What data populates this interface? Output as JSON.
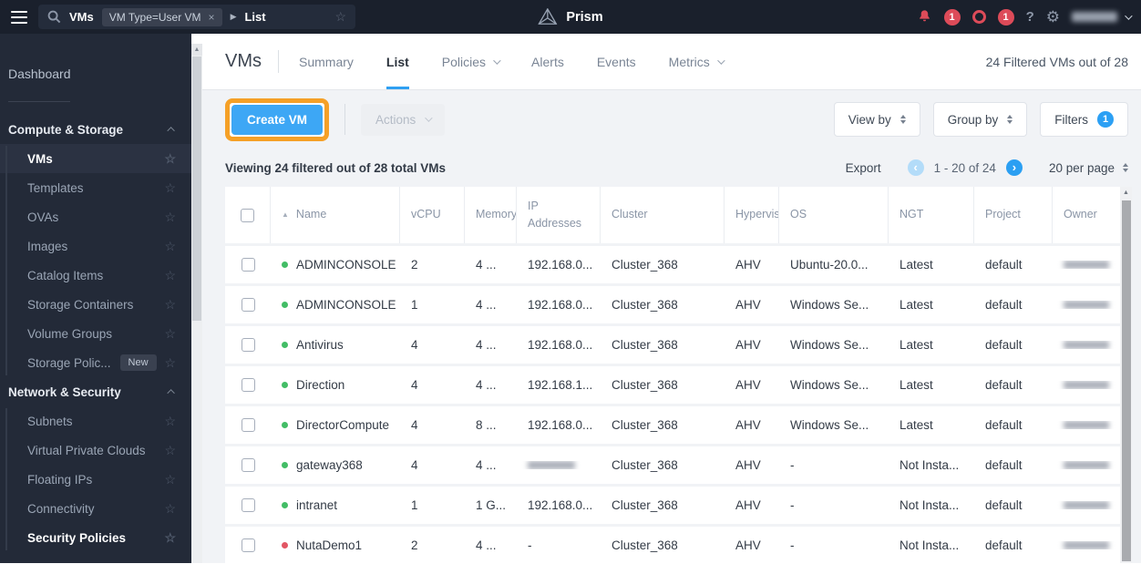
{
  "topbar": {
    "entity": "VMs",
    "filter_chip": "VM Type=User VM",
    "chip_close": "×",
    "crumb": "List",
    "brand": "Prism",
    "alert_badge": "1",
    "anomaly_badge": "1",
    "help_label": "?"
  },
  "sidebar": {
    "dashboard": "Dashboard",
    "sections": [
      {
        "label": "Compute & Storage",
        "items": [
          {
            "label": "VMs",
            "active": true
          },
          {
            "label": "Templates"
          },
          {
            "label": "OVAs"
          },
          {
            "label": "Images"
          },
          {
            "label": "Catalog Items"
          },
          {
            "label": "Storage Containers"
          },
          {
            "label": "Volume Groups"
          },
          {
            "label": "Storage Polic...",
            "badge": "New"
          }
        ]
      },
      {
        "label": "Network & Security",
        "items": [
          {
            "label": "Subnets"
          },
          {
            "label": "Virtual Private Clouds"
          },
          {
            "label": "Floating IPs"
          },
          {
            "label": "Connectivity"
          },
          {
            "label": "Security Policies",
            "emphasis": true
          }
        ]
      }
    ]
  },
  "header": {
    "title": "VMs",
    "tabs": [
      {
        "label": "Summary"
      },
      {
        "label": "List",
        "active": true
      },
      {
        "label": "Policies",
        "dropdown": true
      },
      {
        "label": "Alerts"
      },
      {
        "label": "Events"
      },
      {
        "label": "Metrics",
        "dropdown": true
      }
    ],
    "filtered_summary": "24 Filtered VMs out of 28"
  },
  "toolbar": {
    "create_vm": "Create VM",
    "actions": "Actions",
    "view_by": "View by",
    "group_by": "Group by",
    "filters": "Filters",
    "filters_count": "1"
  },
  "infobar": {
    "viewing": "Viewing 24 filtered out of 28 total VMs",
    "export": "Export",
    "page_range": "1 - 20 of 24",
    "per_page": "20 per page"
  },
  "table": {
    "columns": [
      "Name",
      "vCPU",
      "Memory",
      "IP Addresses",
      "Cluster",
      "Hypervis",
      "OS",
      "NGT",
      "Project",
      "Owner"
    ],
    "sort_column": "Name",
    "rows": [
      {
        "status": "green",
        "name": "ADMINCONSOLE",
        "vcpu": "2",
        "memory": "4 ...",
        "ip": "192.168.0...",
        "cluster": "Cluster_368",
        "hypervisor": "AHV",
        "os": "Ubuntu-20.0...",
        "ngt": "Latest",
        "project": "default",
        "owner": null
      },
      {
        "status": "green",
        "name": "ADMINCONSOLE",
        "vcpu": "1",
        "memory": "4 ...",
        "ip": "192.168.0...",
        "cluster": "Cluster_368",
        "hypervisor": "AHV",
        "os": "Windows Se...",
        "ngt": "Latest",
        "project": "default",
        "owner": null
      },
      {
        "status": "green",
        "name": "Antivirus",
        "vcpu": "4",
        "memory": "4 ...",
        "ip": "192.168.0...",
        "cluster": "Cluster_368",
        "hypervisor": "AHV",
        "os": "Windows Se...",
        "ngt": "Latest",
        "project": "default",
        "owner": null
      },
      {
        "status": "green",
        "name": "Direction",
        "vcpu": "4",
        "memory": "4 ...",
        "ip": "192.168.1...",
        "cluster": "Cluster_368",
        "hypervisor": "AHV",
        "os": "Windows Se...",
        "ngt": "Latest",
        "project": "default",
        "owner": null
      },
      {
        "status": "green",
        "name": "DirectorCompute",
        "vcpu": "4",
        "memory": "8 ...",
        "ip": "192.168.0...",
        "cluster": "Cluster_368",
        "hypervisor": "AHV",
        "os": "Windows Se...",
        "ngt": "Latest",
        "project": "default",
        "owner": null
      },
      {
        "status": "green",
        "name": "gateway368",
        "vcpu": "4",
        "memory": "4 ...",
        "ip": null,
        "cluster": "Cluster_368",
        "hypervisor": "AHV",
        "os": "-",
        "ngt": "Not Insta...",
        "project": "default",
        "owner": null
      },
      {
        "status": "green",
        "name": "intranet",
        "vcpu": "1",
        "memory": "1 G...",
        "ip": "192.168.0...",
        "cluster": "Cluster_368",
        "hypervisor": "AHV",
        "os": "-",
        "ngt": "Not Insta...",
        "project": "default",
        "owner": null
      },
      {
        "status": "red",
        "name": "NutaDemo1",
        "vcpu": "2",
        "memory": "4 ...",
        "ip": "-",
        "cluster": "Cluster_368",
        "hypervisor": "AHV",
        "os": "-",
        "ngt": "Not Insta...",
        "project": "default",
        "owner": null
      }
    ]
  },
  "colors": {
    "accent_blue": "#3DA7F5",
    "highlight_orange": "#F5A027",
    "status_green": "#43BD66",
    "status_red": "#E25664",
    "badge_red": "#DD4B59",
    "badge_blue": "#2CA0F4"
  }
}
